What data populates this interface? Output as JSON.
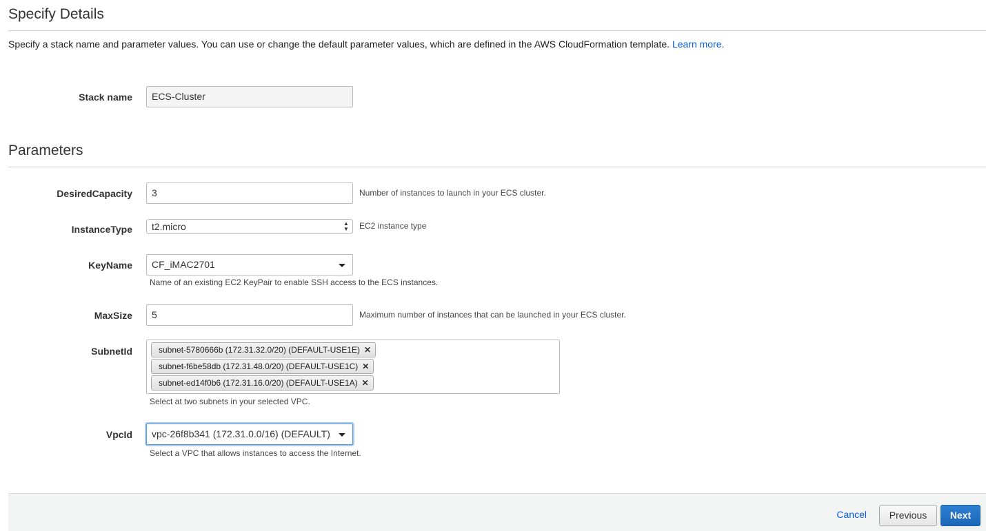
{
  "header": {
    "title": "Specify Details"
  },
  "intro": {
    "text": "Specify a stack name and parameter values. You can use or change the default parameter values, which are defined in the AWS CloudFormation template.",
    "link": "Learn more."
  },
  "stack": {
    "label": "Stack name",
    "value": "ECS-Cluster"
  },
  "parameters": {
    "title": "Parameters",
    "desired_capacity": {
      "label": "DesiredCapacity",
      "value": "3",
      "hint": "Number of instances to launch in your ECS cluster."
    },
    "instance_type": {
      "label": "InstanceType",
      "value": "t2.micro",
      "hint": "EC2 instance type"
    },
    "key_name": {
      "label": "KeyName",
      "value": "CF_iMAC2701",
      "hint": "Name of an existing EC2 KeyPair to enable SSH access to the ECS instances."
    },
    "max_size": {
      "label": "MaxSize",
      "value": "5",
      "hint": "Maximum number of instances that can be launched in your ECS cluster."
    },
    "subnet_id": {
      "label": "SubnetId",
      "chips": [
        "subnet-5780666b (172.31.32.0/20) (DEFAULT-USE1E)",
        "subnet-f6be58db (172.31.48.0/20) (DEFAULT-USE1C)",
        "subnet-ed14f0b6 (172.31.16.0/20) (DEFAULT-USE1A)"
      ],
      "hint": "Select at two subnets in your selected VPC."
    },
    "vpc_id": {
      "label": "VpcId",
      "value": "vpc-26f8b341 (172.31.0.0/16) (DEFAULT)",
      "hint": "Select a VPC that allows instances to access the Internet."
    }
  },
  "footer": {
    "cancel": "Cancel",
    "previous": "Previous",
    "next": "Next"
  }
}
